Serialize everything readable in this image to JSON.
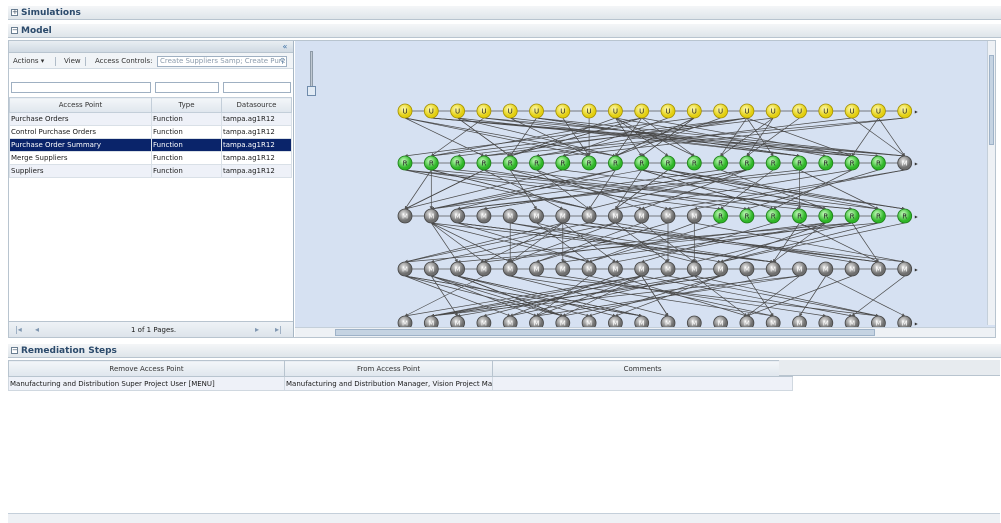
{
  "sections": {
    "simulations": {
      "title": "Simulations",
      "toggle": "+"
    },
    "model": {
      "title": "Model",
      "toggle": "−"
    },
    "remediation": {
      "title": "Remediation Steps",
      "toggle": "−"
    }
  },
  "toolbar": {
    "actions_label": "Actions ▾",
    "view_label": "View",
    "access_controls_label": "Access Controls:",
    "access_controls_value": "Create Suppliers Samp; Create Purch"
  },
  "access_points_table": {
    "columns": [
      "Access Point",
      "Type",
      "Datasource"
    ],
    "rows": [
      {
        "access_point": "Purchase Orders",
        "type": "Function",
        "datasource": "tampa.ag1R12"
      },
      {
        "access_point": "Control Purchase Orders",
        "type": "Function",
        "datasource": "tampa.ag1R12"
      },
      {
        "access_point": "Purchase Order Summary",
        "type": "Function",
        "datasource": "tampa.ag1R12"
      },
      {
        "access_point": "Merge Suppliers",
        "type": "Function",
        "datasource": "tampa.ag1R12"
      },
      {
        "access_point": "Suppliers",
        "type": "Function",
        "datasource": "tampa.ag1R12"
      }
    ],
    "selected_index": 2
  },
  "pager": {
    "text": "1 of 1 Pages."
  },
  "graph": {
    "node_colors": {
      "U": "#f5e72a",
      "R": "#4ad43a",
      "M": "#8a8a8a"
    },
    "row_labels": [
      "U",
      "R",
      "M",
      "M",
      "M"
    ]
  },
  "remediation_table": {
    "columns": [
      "Remove Access Point",
      "From Access Point",
      "Comments"
    ],
    "rows": [
      {
        "remove": "Manufacturing and Distribution Super Project User [MENU]",
        "from": "Manufacturing and Distribution Manager, Vision Project Ma",
        "comments": ""
      }
    ]
  }
}
